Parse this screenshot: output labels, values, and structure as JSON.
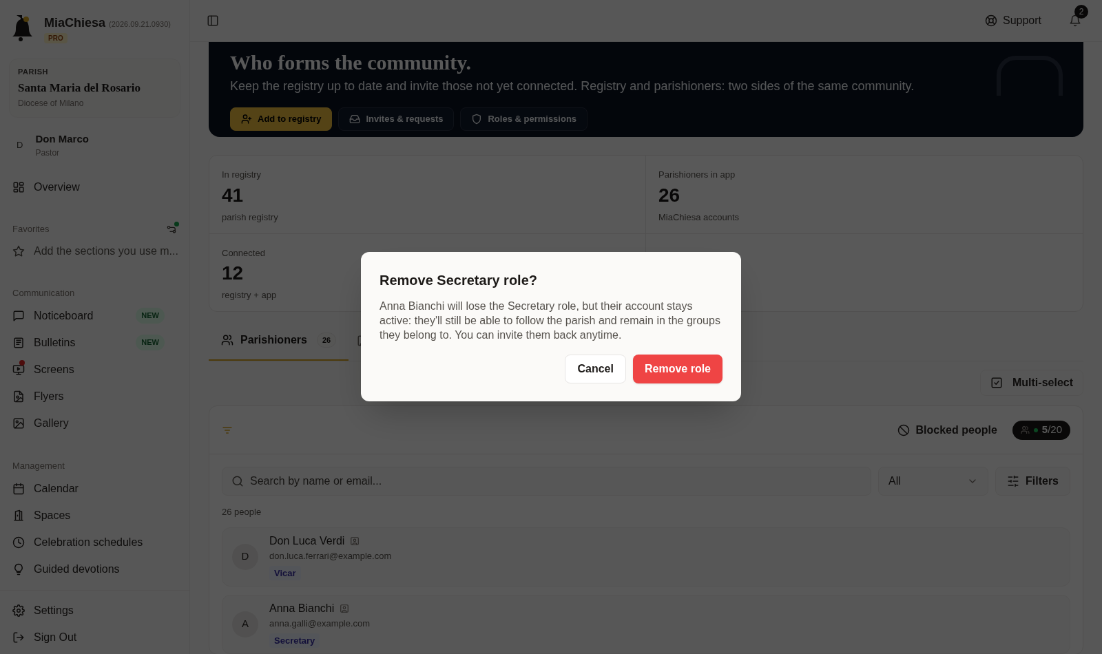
{
  "app": {
    "name": "MiaChiesa",
    "version": "(2026.09.21.0930)",
    "plan": "PRO"
  },
  "parish": {
    "label": "PARISH",
    "name": "Santa Maria del Rosario",
    "diocese": "Diocese of Milano"
  },
  "user": {
    "initial": "D",
    "name": "Don Marco",
    "role": "Pastor"
  },
  "nav_top": [
    {
      "label": "Overview"
    }
  ],
  "favorites": {
    "title": "Favorites",
    "hint": "Add the sections you use m..."
  },
  "sections": [
    {
      "title": "Communication",
      "items": [
        {
          "label": "Noticeboard",
          "badge": "NEW",
          "alert": false
        },
        {
          "label": "Bulletins",
          "badge": "NEW",
          "alert": false
        },
        {
          "label": "Screens",
          "alert": true
        },
        {
          "label": "Flyers",
          "alert": false
        },
        {
          "label": "Gallery",
          "alert": false
        }
      ]
    },
    {
      "title": "Management",
      "items": [
        {
          "label": "Calendar",
          "alert": false
        },
        {
          "label": "Spaces",
          "alert": false
        },
        {
          "label": "Celebration schedules",
          "alert": false
        },
        {
          "label": "Guided devotions",
          "alert": false
        }
      ]
    }
  ],
  "nav_bottom": [
    {
      "label": "Settings"
    },
    {
      "label": "Sign Out"
    }
  ],
  "header": {
    "support": "Support",
    "notifications": "2"
  },
  "hero": {
    "title": "Who forms the community.",
    "subtitle": "Keep the registry up to date and invite those not yet connected. Registry and parishioners: two sides of the same community.",
    "actions": [
      {
        "label": "Add to registry",
        "primary": true
      },
      {
        "label": "Invites & requests",
        "primary": false
      },
      {
        "label": "Roles & permissions",
        "primary": false
      }
    ]
  },
  "stats": [
    {
      "label": "In registry",
      "value": "41",
      "caption": "parish registry"
    },
    {
      "label": "Parishioners in app",
      "value": "26",
      "caption": "MiaChiesa accounts"
    },
    {
      "label": "Connected",
      "value": "12",
      "caption": "registry + app"
    }
  ],
  "tabs": [
    {
      "label": "Parishioners",
      "count": "26",
      "selected": true
    }
  ],
  "multi_select": "Multi-select",
  "people_panel": {
    "blocked": "Blocked people",
    "capacity": "**5**/20",
    "search_placeholder": "Search by name or email...",
    "filter_value": "All",
    "filters": "Filters",
    "count": "26 people",
    "people": [
      {
        "initial": "D",
        "name": "Don Luca Verdi",
        "email": "don.luca.ferrari@example.com",
        "role": "Vicar"
      },
      {
        "initial": "A",
        "name": "Anna Bianchi",
        "email": "anna.galli@example.com",
        "role": "Secretary"
      }
    ]
  },
  "dialog": {
    "title": "Remove Secretary role?",
    "body": "Anna Bianchi will lose the Secretary role, but their account stays active: they'll still be able to follow the parish and remain in the groups they belong to. You can invite them back anytime.",
    "cancel": "Cancel",
    "confirm": "Remove role"
  }
}
